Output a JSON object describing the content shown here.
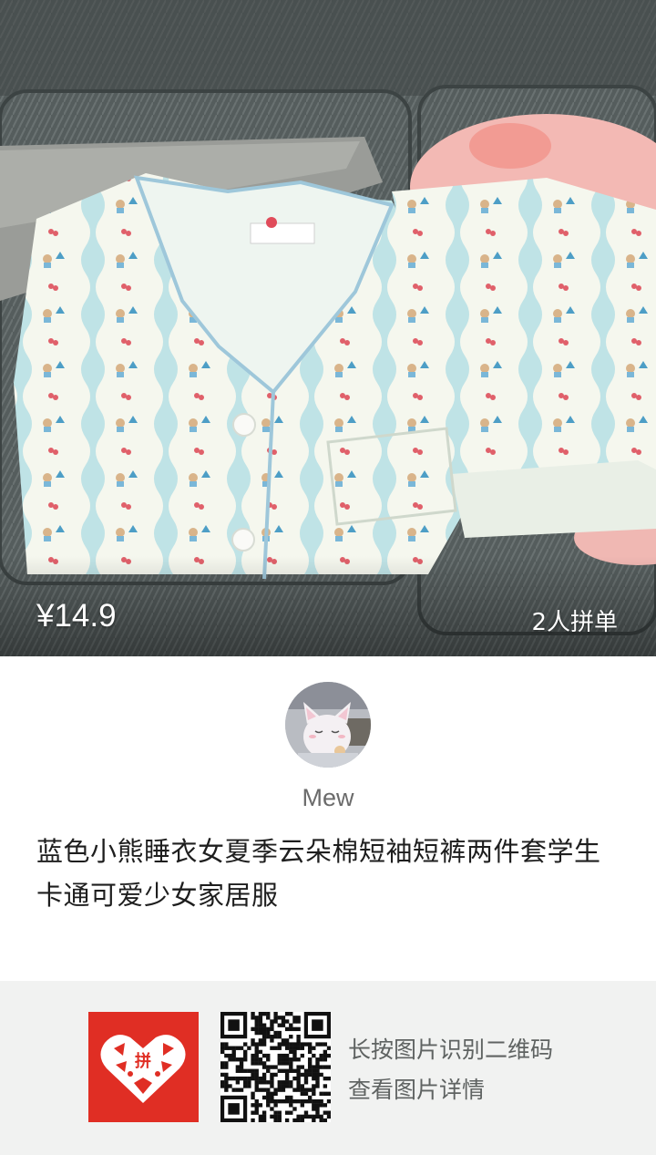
{
  "product": {
    "price": "¥14.9",
    "group_label": "2人拼单",
    "title": "蓝色小熊睡衣女夏季云朵棉短袖短裤两件套学生卡通可爱少女家居服"
  },
  "seller": {
    "name": "Mew",
    "avatar_icon": "cat-avatar-icon"
  },
  "footer": {
    "logo_icon": "pinduoduo-logo-icon",
    "logo_text": "拼",
    "qr_icon": "qr-code-icon",
    "hint_line1": "长按图片识别二维码",
    "hint_line2": "查看图片详情"
  },
  "colors": {
    "brand_red": "#e02e24",
    "footer_bg": "#f1f2f1",
    "pajama_stripe": "#bfe3e6"
  }
}
